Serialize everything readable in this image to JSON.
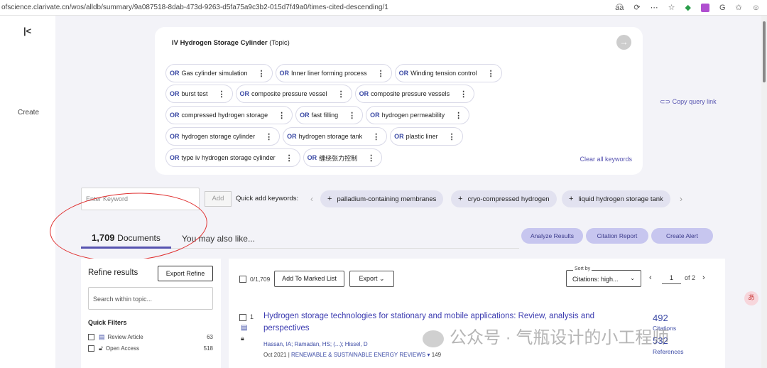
{
  "browser": {
    "url": "ofscience.clarivate.cn/wos/alldb/summary/9a087518-8dab-473d-9263-d5fa75a9c3b2-015d7f49a0/times-cited-descending/1",
    "tool_icons": [
      "translate-icon",
      "refresh-icon",
      "more-icon",
      "star-icon",
      "shield-icon",
      "ext-icon",
      "ext-g-icon",
      "favorites-icon",
      "profile-icon"
    ]
  },
  "rail": {
    "create_label": "Create"
  },
  "query": {
    "title": "IV Hydrogen Storage Cylinder",
    "title_suffix": "(Topic)",
    "or_label": "OR",
    "keywords": [
      "Gas cylinder simulation",
      "Inner liner forming process",
      "Winding tension control",
      "burst test",
      "composite pressure vessel",
      "composite pressure vessels",
      "compressed hydrogen storage",
      "fast filling",
      "hydrogen permeability",
      "hydrogen storage cylinder",
      "hydrogen storage tank",
      "plastic liner",
      "type iv hydrogen storage cylinder",
      "缠绕张力控制"
    ],
    "clear_all": "Clear all keywords",
    "copy_link": "Copy query link"
  },
  "keyword_entry": {
    "placeholder": "Enter Keyword",
    "add_label": "Add",
    "quick_add_label": "Quick add keywords:",
    "quick_add": [
      "palladium-containing membranes",
      "cryo-compressed hydrogen",
      "liquid hydrogen storage tank"
    ]
  },
  "tabs": {
    "count": "1,709",
    "documents_label": "Documents",
    "also_like": "You may also like..."
  },
  "actions": {
    "analyze": "Analyze Results",
    "citation_report": "Citation Report",
    "create_alert": "Create Alert"
  },
  "refine": {
    "title": "Refine results",
    "export": "Export Refine",
    "search_placeholder": "Search within topic...",
    "quick_filters_title": "Quick Filters",
    "filters": [
      {
        "label": "Review Article",
        "count": "63"
      },
      {
        "label": "Open Access",
        "count": "518"
      }
    ]
  },
  "results_toolbar": {
    "selected": "0/1,709",
    "add_marked": "Add To Marked List",
    "export": "Export",
    "sort_label": "Sort by",
    "sort_value": "Citations: high...",
    "page": "1",
    "of_pages": "of 2"
  },
  "record": {
    "number": "1",
    "title": "Hydrogen storage technologies for stationary and mobile applications: Review, analysis and perspectives",
    "authors": "Hassan, IA; Ramadan, HS; (...); Hissel, D",
    "date": "Oct 2021",
    "journal": "RENEWABLE & SUSTAINABLE ENERGY REVIEWS",
    "volume": "149",
    "citations": "492",
    "citations_label": "Citations",
    "references": "532",
    "references_label": "References"
  },
  "watermark": "公众号 · 气瓶设计的小工程师"
}
